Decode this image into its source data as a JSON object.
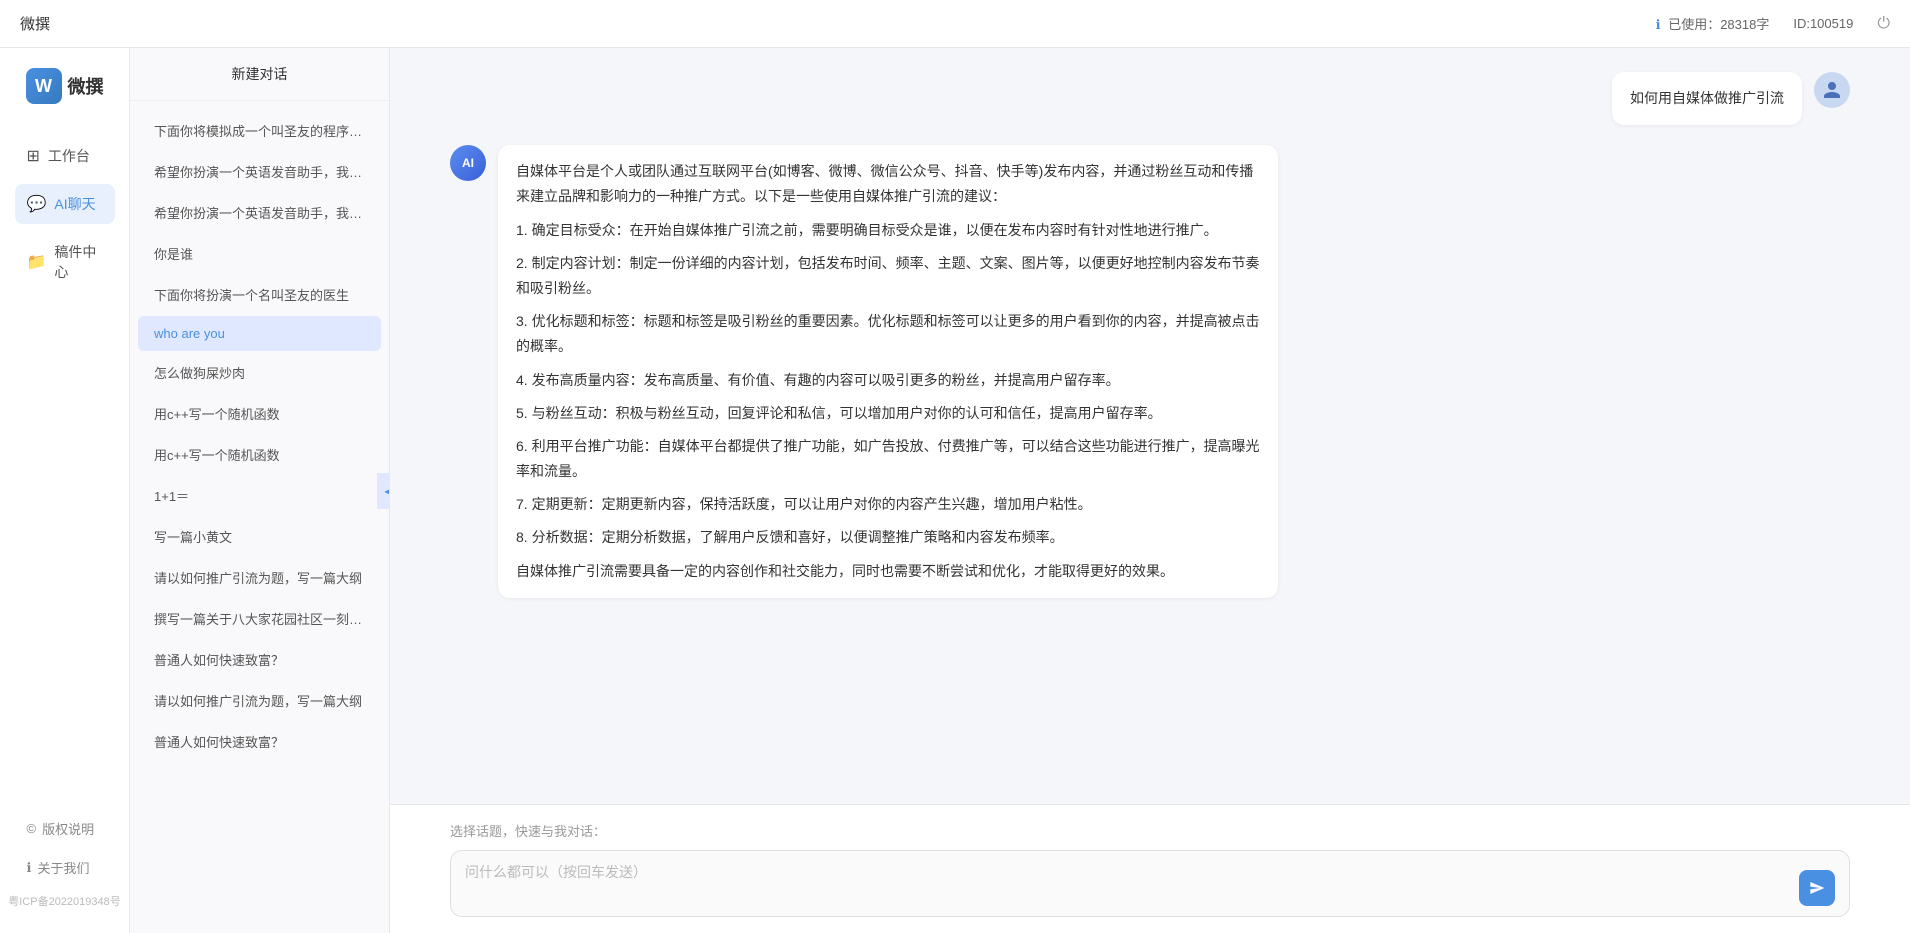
{
  "topbar": {
    "title": "微撰",
    "usage_label": "已使用：28318字",
    "id_label": "ID:100519",
    "usage_icon": "ℹ"
  },
  "logo": {
    "w": "W",
    "text": "微撰"
  },
  "nav": {
    "items": [
      {
        "id": "workbench",
        "icon": "⊞",
        "label": "工作台"
      },
      {
        "id": "ai-chat",
        "icon": "💬",
        "label": "AI聊天"
      },
      {
        "id": "drafts",
        "icon": "📁",
        "label": "稿件中心"
      }
    ],
    "bottom": [
      {
        "id": "copyright",
        "icon": "©",
        "label": "版权说明"
      },
      {
        "id": "about",
        "icon": "ℹ",
        "label": "关于我们"
      }
    ],
    "icp": "粤ICP备2022019348号"
  },
  "sidebar": {
    "new_chat": "新建对话",
    "collapse_icon": "◀",
    "items": [
      {
        "id": 1,
        "text": "下面你将模拟成一个叫圣友的程序员、我说..."
      },
      {
        "id": 2,
        "text": "希望你扮演一个英语发音助手，我提供给你..."
      },
      {
        "id": 3,
        "text": "希望你扮演一个英语发音助手，我提供给你..."
      },
      {
        "id": 4,
        "text": "你是谁",
        "active": true
      },
      {
        "id": 5,
        "text": "下面你将扮演一个名叫圣友的医生"
      },
      {
        "id": 6,
        "text": "who are you"
      },
      {
        "id": 7,
        "text": "怎么做狗屎炒肉"
      },
      {
        "id": 8,
        "text": "用c++写一个随机函数"
      },
      {
        "id": 9,
        "text": "用c++写一个随机函数"
      },
      {
        "id": 10,
        "text": "1+1＝"
      },
      {
        "id": 11,
        "text": "写一篇小黄文"
      },
      {
        "id": 12,
        "text": "请以如何推广引流为题，写一篇大纲"
      },
      {
        "id": 13,
        "text": "撰写一篇关于八大家花园社区一刻钟便民生..."
      },
      {
        "id": 14,
        "text": "普通人如何快速致富？"
      },
      {
        "id": 15,
        "text": "请以如何推广引流为题，写一篇大纲"
      },
      {
        "id": 16,
        "text": "普通人如何快速致富？"
      }
    ]
  },
  "chat": {
    "user_avatar": "👤",
    "ai_avatar": "AI",
    "messages": [
      {
        "role": "user",
        "text": "如何用自媒体做推广引流"
      },
      {
        "role": "ai",
        "paragraphs": [
          "自媒体平台是个人或团队通过互联网平台(如博客、微博、微信公众号、抖音、快手等)发布内容，并通过粉丝互动和传播来建立品牌和影响力的一种推广方式。以下是一些使用自媒体推广引流的建议：",
          "1. 确定目标受众：在开始自媒体推广引流之前，需要明确目标受众是谁，以便在发布内容时有针对性地进行推广。",
          "2. 制定内容计划：制定一份详细的内容计划，包括发布时间、频率、主题、文案、图片等，以便更好地控制内容发布节奏和吸引粉丝。",
          "3. 优化标题和标签：标题和标签是吸引粉丝的重要因素。优化标题和标签可以让更多的用户看到你的内容，并提高被点击的概率。",
          "4. 发布高质量内容：发布高质量、有价值、有趣的内容可以吸引更多的粉丝，并提高用户留存率。",
          "5. 与粉丝互动：积极与粉丝互动，回复评论和私信，可以增加用户对你的认可和信任，提高用户留存率。",
          "6. 利用平台推广功能：自媒体平台都提供了推广功能，如广告投放、付费推广等，可以结合这些功能进行推广，提高曝光率和流量。",
          "7. 定期更新：定期更新内容，保持活跃度，可以让用户对你的内容产生兴趣，增加用户粘性。",
          "8. 分析数据：定期分析数据，了解用户反馈和喜好，以便调整推广策略和内容发布频率。",
          "自媒体推广引流需要具备一定的内容创作和社交能力，同时也需要不断尝试和优化，才能取得更好的效果。"
        ]
      }
    ],
    "quick_topics_label": "选择话题，快速与我对话：",
    "input_placeholder": "问什么都可以（按回车发送）",
    "send_icon": "➤"
  }
}
